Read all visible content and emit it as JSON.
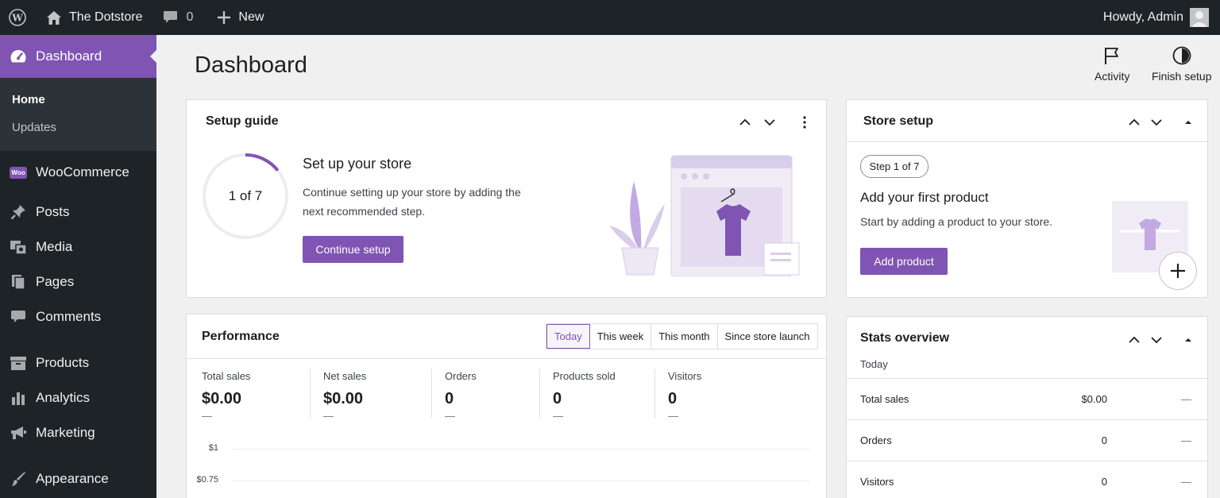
{
  "adminbar": {
    "site_name": "The Dotstore",
    "comments_count": "0",
    "new_label": "New",
    "greeting": "Howdy, Admin"
  },
  "sidebar": {
    "dashboard_label": "Dashboard",
    "submenu": [
      {
        "label": "Home"
      },
      {
        "label": "Updates"
      }
    ],
    "woo_badge": "Woo",
    "items": [
      {
        "label": "WooCommerce",
        "icon": "woocommerce-icon"
      },
      {
        "label": "Posts",
        "icon": "pin-icon"
      },
      {
        "label": "Media",
        "icon": "media-icon"
      },
      {
        "label": "Pages",
        "icon": "pages-icon"
      },
      {
        "label": "Comments",
        "icon": "comment-icon"
      },
      {
        "label": "Products",
        "icon": "archive-icon"
      },
      {
        "label": "Analytics",
        "icon": "bar-chart-icon"
      },
      {
        "label": "Marketing",
        "icon": "megaphone-icon"
      },
      {
        "label": "Appearance",
        "icon": "brush-icon"
      }
    ]
  },
  "page": {
    "title": "Dashboard",
    "activity_label": "Activity",
    "finish_setup_label": "Finish setup"
  },
  "setup_guide": {
    "title": "Setup guide",
    "progress_label": "1 of 7",
    "progress_fraction": 0.142857,
    "heading": "Set up your store",
    "description": "Continue setting up your store by adding the next recommended step.",
    "button": "Continue setup"
  },
  "store_setup": {
    "title": "Store setup",
    "step_label": "Step 1 of 7",
    "heading": "Add your first product",
    "description": "Start by adding a product to your store.",
    "button": "Add product"
  },
  "performance": {
    "title": "Performance",
    "tabs": [
      {
        "label": "Today",
        "active": true
      },
      {
        "label": "This week",
        "active": false
      },
      {
        "label": "This month",
        "active": false
      },
      {
        "label": "Since store launch",
        "active": false
      }
    ],
    "metrics": [
      {
        "label": "Total sales",
        "value": "$0.00",
        "delta": "—"
      },
      {
        "label": "Net sales",
        "value": "$0.00",
        "delta": "—"
      },
      {
        "label": "Orders",
        "value": "0",
        "delta": "—"
      },
      {
        "label": "Products sold",
        "value": "0",
        "delta": "—"
      },
      {
        "label": "Visitors",
        "value": "0",
        "delta": "—"
      }
    ],
    "y_ticks": [
      "$1",
      "$0.75"
    ]
  },
  "stats_overview": {
    "title": "Stats overview",
    "period": "Today",
    "rows": [
      {
        "label": "Total sales",
        "value": "$0.00",
        "trend": "—"
      },
      {
        "label": "Orders",
        "value": "0",
        "trend": "—"
      },
      {
        "label": "Visitors",
        "value": "0",
        "trend": "—"
      }
    ]
  },
  "colors": {
    "accent": "#7f54b3",
    "adminbar": "#1d2327",
    "background": "#f0f0f1"
  }
}
